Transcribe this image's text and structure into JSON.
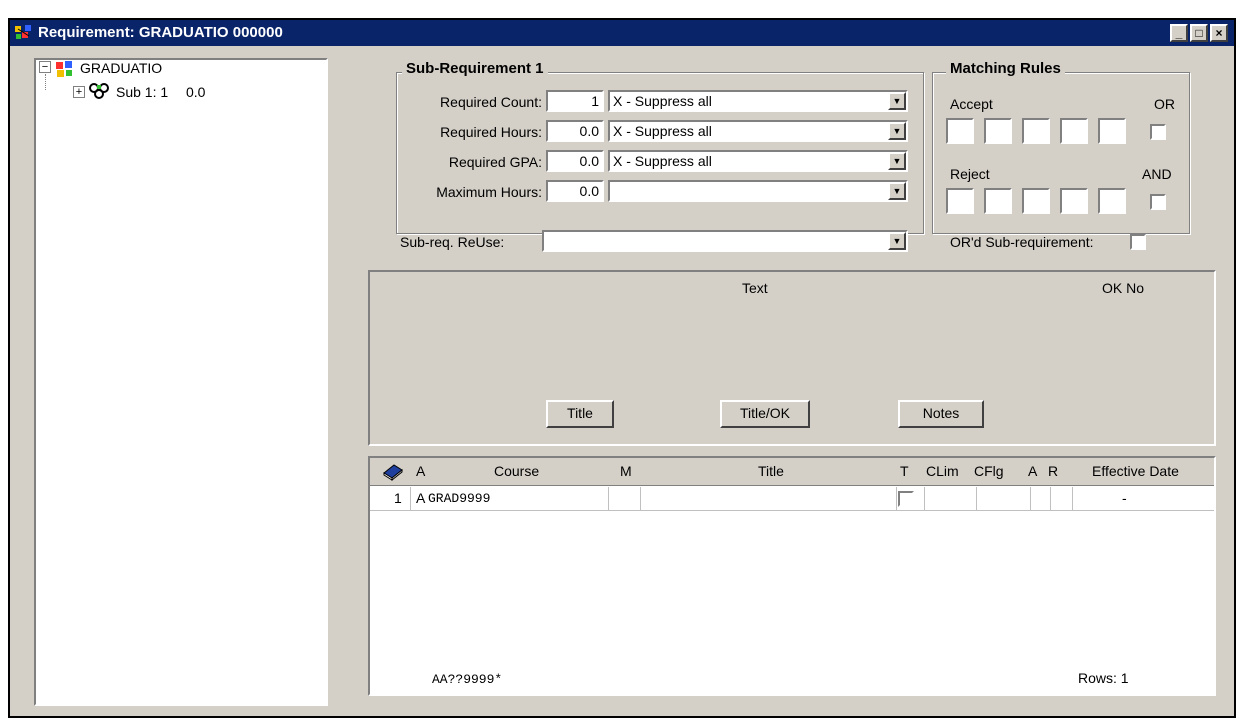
{
  "window": {
    "title": "Requirement: GRADUATIO 000000",
    "min_icon": "minimize-icon",
    "max_icon": "maximize-icon",
    "close_icon": "close-icon"
  },
  "tree": {
    "root_label": "GRADUATIO",
    "child_label": "Sub 1:  1",
    "child_value": "0.0",
    "expand_root": "⊟",
    "expand_child": "⊞"
  },
  "subreq": {
    "title": "Sub-Requirement 1",
    "rows": [
      {
        "label": "Required Count:",
        "value": "1",
        "option": "X - Suppress all"
      },
      {
        "label": "Required Hours:",
        "value": "0.0",
        "option": "X - Suppress all"
      },
      {
        "label": "Required GPA:",
        "value": "0.0",
        "option": "X - Suppress all"
      },
      {
        "label": "Maximum Hours:",
        "value": "0.0",
        "option": ""
      }
    ],
    "reuse_label": "Sub-req. ReUse:",
    "reuse_value": ""
  },
  "matching": {
    "title": "Matching Rules",
    "accept": "Accept",
    "or": "OR",
    "reject": "Reject",
    "and": "AND",
    "ord_label": "OR'd Sub-requirement:"
  },
  "text_panel": {
    "text_header": "Text",
    "ok_no_header": "OK  No",
    "buttons": [
      "Title",
      "Title/OK",
      "Notes"
    ]
  },
  "grid": {
    "headers": {
      "a": "A",
      "course": "Course",
      "m": "M",
      "title": "Title",
      "t": "T",
      "clim": "CLim",
      "cflg": "CFlg",
      "a2": "A",
      "r": "R",
      "eff": "Effective Date"
    },
    "rows": [
      {
        "num": "1",
        "a": "A",
        "course": "GRAD9999",
        "m": "",
        "title": "",
        "clim": "",
        "cflg": "",
        "a2": "",
        "r": "",
        "eff": "-"
      }
    ],
    "footer_pattern": "AA??9999*",
    "footer_rows": "Rows: 1"
  },
  "colors": {
    "titlebar": "#0a246a",
    "face": "#d4d0c8",
    "book": "#1f3f9f"
  }
}
